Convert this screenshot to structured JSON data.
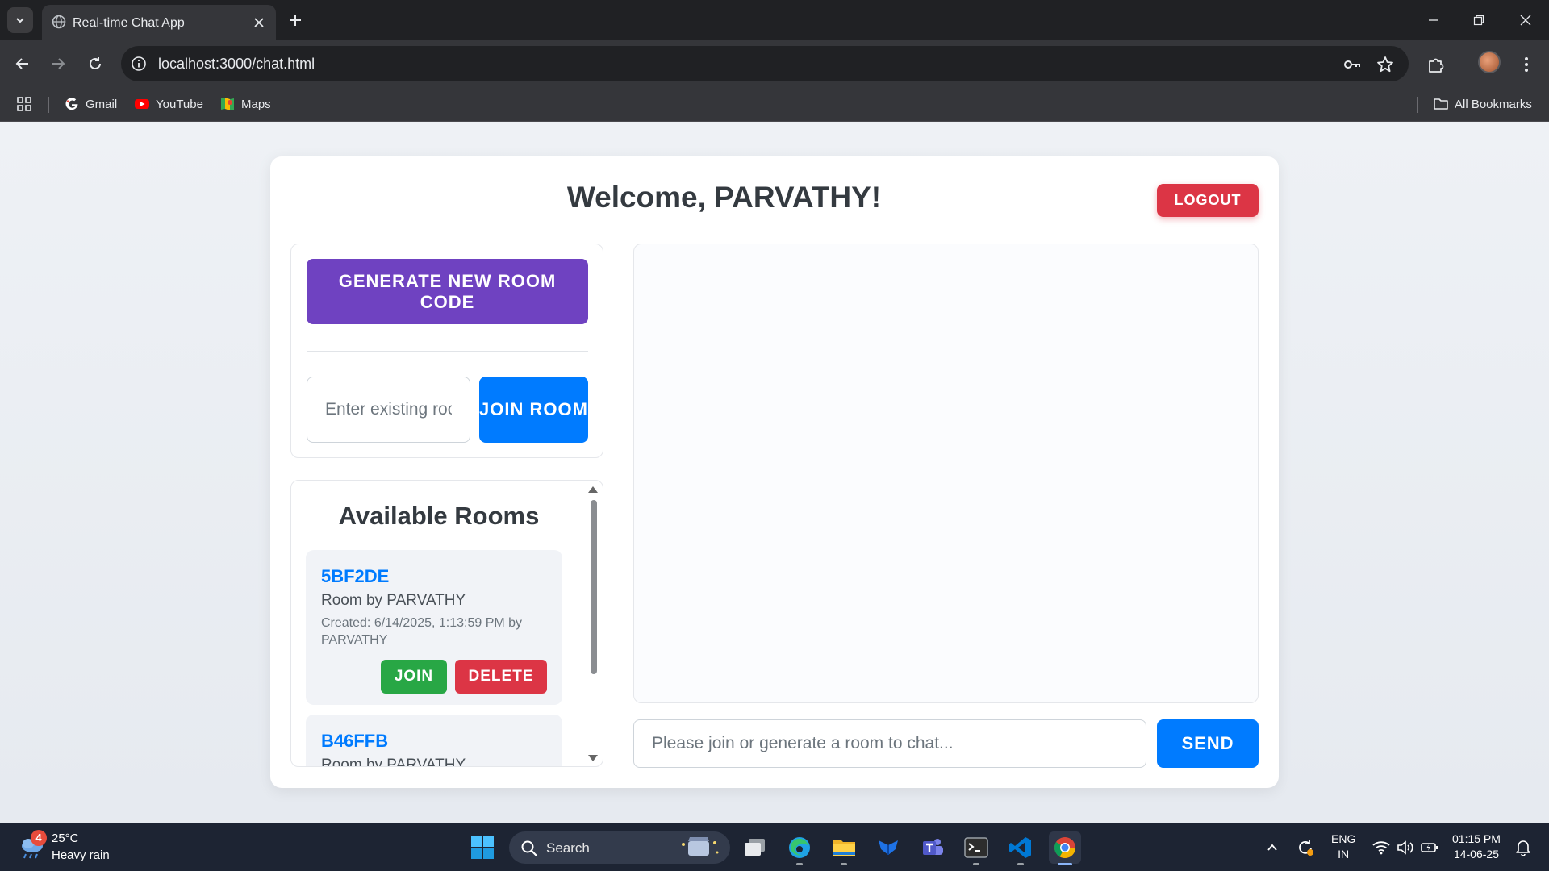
{
  "browser": {
    "tab_title": "Real-time Chat App",
    "url": "localhost:3000/chat.html",
    "bookmarks": [
      {
        "label": "Gmail",
        "icon": "google-icon"
      },
      {
        "label": "YouTube",
        "icon": "youtube-icon"
      },
      {
        "label": "Maps",
        "icon": "maps-icon"
      }
    ],
    "all_bookmarks_label": "All Bookmarks"
  },
  "page": {
    "welcome": "Welcome, PARVATHY!",
    "logout_label": "LOGOUT",
    "generate_label": "GENERATE NEW ROOM CODE",
    "room_input_placeholder": "Enter existing room code",
    "join_room_label": "JOIN ROOM",
    "rooms_title": "Available Rooms",
    "rooms": [
      {
        "code": "5BF2DE",
        "owner": "Room by PARVATHY",
        "created": "Created: 6/14/2025, 1:13:59 PM by PARVATHY",
        "join_label": "JOIN",
        "delete_label": "DELETE"
      },
      {
        "code": "B46FFB",
        "owner": "Room by PARVATHY"
      }
    ],
    "message_placeholder": "Please join or generate a room to chat...",
    "send_label": "SEND"
  },
  "taskbar": {
    "weather_temp": "25°C",
    "weather_desc": "Heavy rain",
    "weather_badge": "4",
    "search_label": "Search",
    "lang_line1": "ENG",
    "lang_line2": "IN",
    "time": "01:15 PM",
    "date": "14-06-25"
  },
  "colors": {
    "primary": "#007bff",
    "purple": "#6f42c1",
    "danger": "#dc3545",
    "success": "#28a745"
  }
}
